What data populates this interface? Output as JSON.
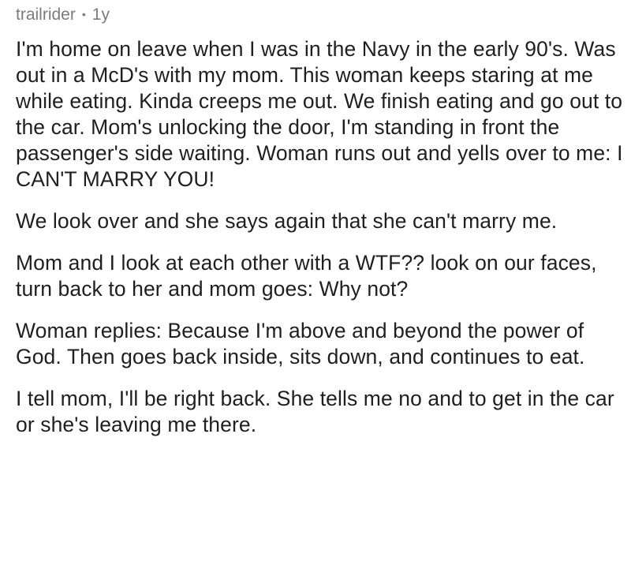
{
  "comment": {
    "author": "trailrider",
    "separator": "•",
    "age": "1y",
    "paragraphs": [
      "I'm home on leave when I was in the Navy in the early 90's.  Was out in a McD's with my mom.  This woman keeps staring at me while eating. Kinda creeps me out. We finish eating and go out to the car.  Mom's unlocking the door, I'm standing in front the passenger's side waiting.  Woman runs out and yells over to me:  I CAN'T MARRY YOU!",
      "We look over and she says again that she can't marry me.",
      "Mom and I look at each other with a WTF?? look on our faces, turn back to her and mom goes:  Why not?",
      "Woman replies:  Because I'm above and beyond the power of God.  Then goes back inside, sits down, and continues to eat.",
      "I tell mom, I'll be right back.  She tells me no and to get in the car or she's leaving me there."
    ]
  }
}
